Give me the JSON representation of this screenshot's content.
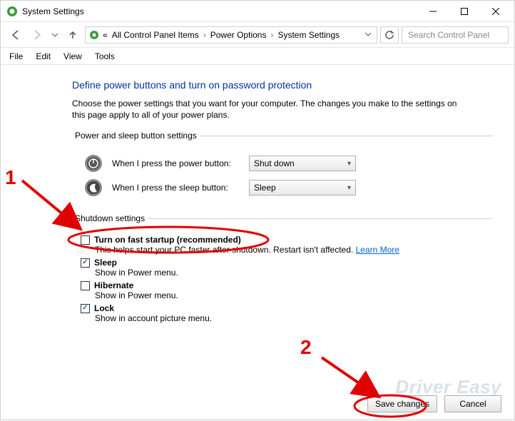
{
  "window": {
    "title": "System Settings"
  },
  "breadcrumbs": {
    "chevrons": "«",
    "item1": "All Control Panel Items",
    "item2": "Power Options",
    "item3": "System Settings"
  },
  "search": {
    "placeholder": "Search Control Panel"
  },
  "menubar": {
    "file": "File",
    "edit": "Edit",
    "view": "View",
    "tools": "Tools"
  },
  "main": {
    "heading": "Define power buttons and turn on password protection",
    "desc": "Choose the power settings that you want for your computer. The changes you make to the settings on this page apply to all of your power plans.",
    "group1_legend": "Power and sleep button settings",
    "power_label": "When I press the power button:",
    "power_value": "Shut down",
    "sleep_label": "When I press the sleep button:",
    "sleep_value": "Sleep",
    "group2_legend": "Shutdown settings",
    "items": {
      "fast": {
        "title": "Turn on fast startup (recommended)",
        "sub": "This helps start your PC faster after shutdown. Restart isn't affected. ",
        "link": "Learn More"
      },
      "sleep": {
        "title": "Sleep",
        "sub": "Show in Power menu."
      },
      "hibernate": {
        "title": "Hibernate",
        "sub": "Show in Power menu."
      },
      "lock": {
        "title": "Lock",
        "sub": "Show in account picture menu."
      }
    }
  },
  "buttons": {
    "save": "Save changes",
    "cancel": "Cancel"
  },
  "annotations": {
    "n1": "1",
    "n2": "2"
  },
  "watermark": "Driver Easy"
}
